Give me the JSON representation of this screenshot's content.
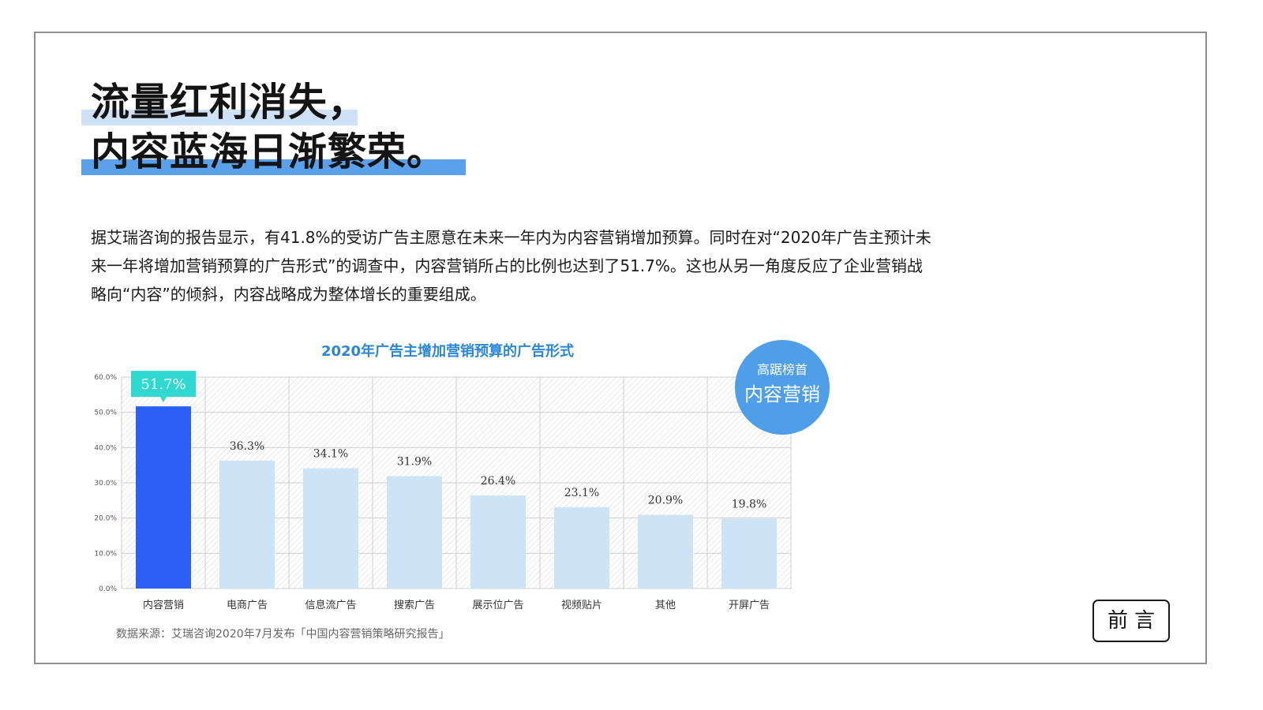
{
  "headline": {
    "line1": "流量红利消失，",
    "line2": "内容蓝海日渐繁荣。"
  },
  "intro": [
    "据艾瑞咨询的报告显示，有41.8%的受访广告主愿意在未来一年内为内容营销增加预算。同时在对“2020年广告主预计未",
    "来一年将增加营销预算的广告形式”的调查中，内容营销所占的比例也达到了51.7%。这也从另一角度反应了企业营销战",
    "略向“内容”的倾斜，内容战略成为整体增长的重要组成。"
  ],
  "badge": {
    "line1": "高踞榜首",
    "line2": "内容营销"
  },
  "source": "数据来源：艾瑞咨询2020年7月发布「中国内容营销策略研究报告」",
  "nav": {
    "label": "前言"
  },
  "colors": {
    "highlight_bar": "#2b5ff5",
    "bar": "#cde3f6",
    "callout": "#2fd9cf",
    "title": "#2b86d8",
    "badge": "#4f9ee8"
  },
  "chart_data": {
    "type": "bar",
    "title": "2020年广告主增加营销预算的广告形式",
    "categories": [
      "内容营销",
      "电商广告",
      "信息流广告",
      "搜索广告",
      "展示位广告",
      "视频贴片",
      "其他",
      "开屏广告"
    ],
    "values": [
      51.7,
      36.3,
      34.1,
      31.9,
      26.4,
      23.1,
      20.9,
      19.8
    ],
    "value_labels": [
      "51.7%",
      "36.3%",
      "34.1%",
      "31.9%",
      "26.4%",
      "23.1%",
      "20.9%",
      "19.8%"
    ],
    "yticks": [
      "0.0%",
      "10.0%",
      "20.0%",
      "30.0%",
      "40.0%",
      "50.0%",
      "60.0%"
    ],
    "ylim": [
      0,
      60
    ],
    "grid": true,
    "highlight_index": 0
  }
}
